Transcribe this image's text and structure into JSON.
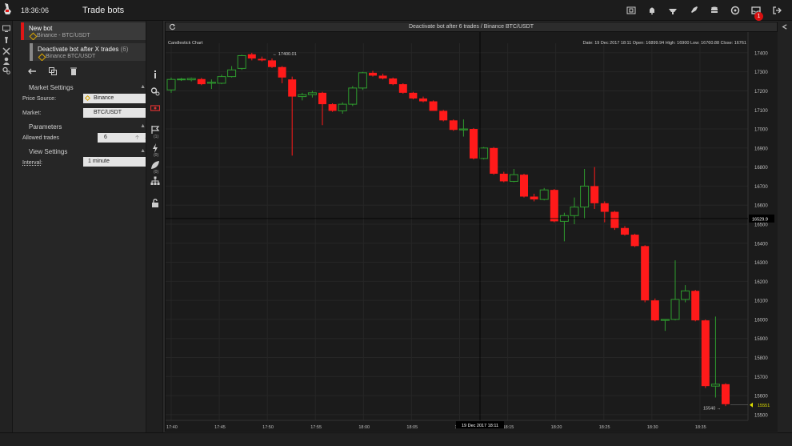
{
  "header": {
    "time": "18:36:06",
    "title": "Trade bots",
    "notification_count": "1"
  },
  "bots": [
    {
      "name": "New bot",
      "sub": "Binance - BTC/USDT"
    },
    {
      "name": "Deactivate bot after X trades",
      "count": "(6)",
      "sub": "Binance BTC/USDT"
    }
  ],
  "sections": {
    "market": "Market Settings",
    "parameters": "Parameters",
    "view": "View Settings"
  },
  "fields": {
    "price_source_label": "Price Source:",
    "price_source_value": "Binance",
    "market_label": "Market:",
    "market_value": "BTC/USDT",
    "allowed_trades_label": "Allowed trades",
    "allowed_trades_value": "6",
    "interval_label": "Interval:",
    "interval_value": "1 minute"
  },
  "toolrail": {
    "badge_a": "(1)",
    "badge_b": "(0)",
    "badge_c": "(0)"
  },
  "chart_window": {
    "title": "Deactivate bot after 6 trades / Binance BTC/USDT"
  },
  "chart_data": {
    "type": "candlestick",
    "title": "Candlestick Chart",
    "info": "Date: 19 Dec 2017 18:11  Open: 16899.94  High: 16900  Low: 16760.88  Close: 16761",
    "ylim": [
      15470,
      17450
    ],
    "yticks": [
      17400,
      17300,
      17200,
      17100,
      17000,
      16900,
      16800,
      16700,
      16600,
      16500,
      16400,
      16300,
      16200,
      16100,
      16000,
      15900,
      15800,
      15700,
      15600,
      15500
    ],
    "xticks": [
      "17:40",
      "17:45",
      "17:50",
      "17:55",
      "18:00",
      "18:05",
      "18:10",
      "18:15",
      "18:20",
      "18:25",
      "18:30",
      "18:35"
    ],
    "crosshair_price": "16529.9",
    "crosshair_time": "19 Dec 2017 18:11",
    "current_price": "15551",
    "high_marker": "17400.01",
    "low_marker": "15540",
    "candles": [
      {
        "o": 17205,
        "h": 17270,
        "l": 17190,
        "c": 17260
      },
      {
        "o": 17260,
        "h": 17268,
        "l": 17252,
        "c": 17262
      },
      {
        "o": 17258,
        "h": 17270,
        "l": 17250,
        "c": 17265
      },
      {
        "o": 17262,
        "h": 17268,
        "l": 17230,
        "c": 17235
      },
      {
        "o": 17240,
        "h": 17260,
        "l": 17210,
        "c": 17245
      },
      {
        "o": 17240,
        "h": 17285,
        "l": 17235,
        "c": 17275
      },
      {
        "o": 17275,
        "h": 17330,
        "l": 17270,
        "c": 17310
      },
      {
        "o": 17318,
        "h": 17390,
        "l": 17310,
        "c": 17385
      },
      {
        "o": 17392,
        "h": 17400,
        "l": 17360,
        "c": 17370
      },
      {
        "o": 17368,
        "h": 17380,
        "l": 17355,
        "c": 17360
      },
      {
        "o": 17360,
        "h": 17370,
        "l": 17320,
        "c": 17325
      },
      {
        "o": 17325,
        "h": 17330,
        "l": 17240,
        "c": 17270
      },
      {
        "o": 17260,
        "h": 17275,
        "l": 16860,
        "c": 17170
      },
      {
        "o": 17170,
        "h": 17190,
        "l": 17150,
        "c": 17180
      },
      {
        "o": 17180,
        "h": 17200,
        "l": 17165,
        "c": 17190
      },
      {
        "o": 17190,
        "h": 17195,
        "l": 17020,
        "c": 17130
      },
      {
        "o": 17130,
        "h": 17135,
        "l": 17090,
        "c": 17095
      },
      {
        "o": 17095,
        "h": 17140,
        "l": 17080,
        "c": 17130
      },
      {
        "o": 17130,
        "h": 17225,
        "l": 17120,
        "c": 17215
      },
      {
        "o": 17215,
        "h": 17300,
        "l": 17205,
        "c": 17295
      },
      {
        "o": 17295,
        "h": 17305,
        "l": 17275,
        "c": 17280
      },
      {
        "o": 17280,
        "h": 17290,
        "l": 17260,
        "c": 17265
      },
      {
        "o": 17265,
        "h": 17270,
        "l": 17230,
        "c": 17235
      },
      {
        "o": 17235,
        "h": 17240,
        "l": 17185,
        "c": 17190
      },
      {
        "o": 17190,
        "h": 17195,
        "l": 17155,
        "c": 17160
      },
      {
        "o": 17160,
        "h": 17170,
        "l": 17140,
        "c": 17145
      },
      {
        "o": 17145,
        "h": 17150,
        "l": 17100,
        "c": 17095
      },
      {
        "o": 17095,
        "h": 17100,
        "l": 17040,
        "c": 17045
      },
      {
        "o": 17045,
        "h": 17050,
        "l": 16990,
        "c": 16995
      },
      {
        "o": 16995,
        "h": 17050,
        "l": 16960,
        "c": 17000
      },
      {
        "o": 17000,
        "h": 17005,
        "l": 16840,
        "c": 16845
      },
      {
        "o": 16845,
        "h": 16905,
        "l": 16840,
        "c": 16900
      },
      {
        "o": 16900,
        "h": 16905,
        "l": 16760,
        "c": 16765
      },
      {
        "o": 16765,
        "h": 16775,
        "l": 16720,
        "c": 16725
      },
      {
        "o": 16725,
        "h": 16790,
        "l": 16720,
        "c": 16760
      },
      {
        "o": 16760,
        "h": 16765,
        "l": 16640,
        "c": 16645
      },
      {
        "o": 16645,
        "h": 16660,
        "l": 16620,
        "c": 16630
      },
      {
        "o": 16630,
        "h": 16690,
        "l": 16625,
        "c": 16680
      },
      {
        "o": 16680,
        "h": 16685,
        "l": 16510,
        "c": 16515
      },
      {
        "o": 16515,
        "h": 16560,
        "l": 16410,
        "c": 16545
      },
      {
        "o": 16545,
        "h": 16640,
        "l": 16500,
        "c": 16590
      },
      {
        "o": 16590,
        "h": 16790,
        "l": 16530,
        "c": 16700
      },
      {
        "o": 16700,
        "h": 16800,
        "l": 16580,
        "c": 16610
      },
      {
        "o": 16610,
        "h": 16620,
        "l": 16510,
        "c": 16565
      },
      {
        "o": 16565,
        "h": 16570,
        "l": 16470,
        "c": 16480
      },
      {
        "o": 16480,
        "h": 16490,
        "l": 16440,
        "c": 16445
      },
      {
        "o": 16445,
        "h": 16450,
        "l": 16380,
        "c": 16385
      },
      {
        "o": 16385,
        "h": 16390,
        "l": 16090,
        "c": 16100
      },
      {
        "o": 16100,
        "h": 16110,
        "l": 15990,
        "c": 15995
      },
      {
        "o": 15995,
        "h": 16000,
        "l": 15940,
        "c": 16000
      },
      {
        "o": 16000,
        "h": 16310,
        "l": 15995,
        "c": 16105
      },
      {
        "o": 16105,
        "h": 16180,
        "l": 16090,
        "c": 16150
      },
      {
        "o": 16150,
        "h": 16155,
        "l": 15990,
        "c": 15995
      },
      {
        "o": 15995,
        "h": 16000,
        "l": 15640,
        "c": 15650
      },
      {
        "o": 15650,
        "h": 16015,
        "l": 15590,
        "c": 15660
      },
      {
        "o": 15660,
        "h": 15665,
        "l": 15545,
        "c": 15555
      }
    ]
  }
}
